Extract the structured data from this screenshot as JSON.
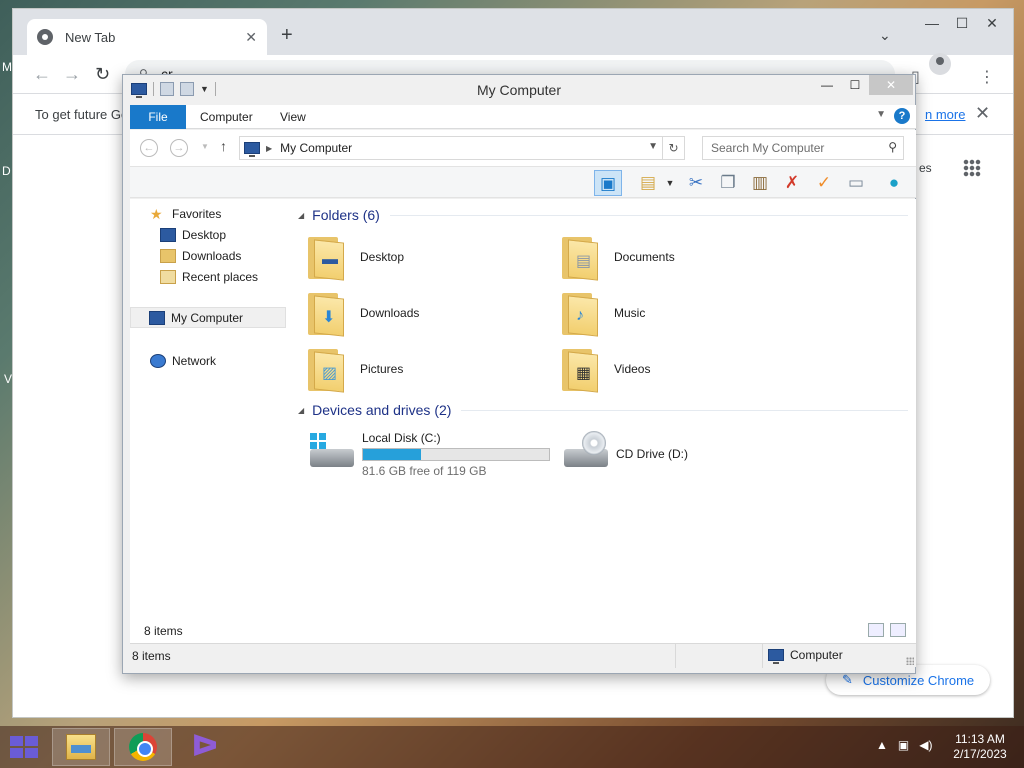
{
  "chrome": {
    "tab_title": "New Tab",
    "tab_close": "✕",
    "new_tab": "+",
    "tab_search": "⌄",
    "window_controls": {
      "minimize": "—",
      "maximize": "☐",
      "close": "✕"
    },
    "omnibox_value": "cr",
    "infobar": {
      "text": "To get future Go",
      "link": "n more",
      "close": "✕"
    },
    "edge_texts": {
      "left_1": "M",
      "left_2": "D",
      "left_3": "V",
      "right_1": "es"
    },
    "customize_label": "Customize Chrome"
  },
  "explorer": {
    "title": "My Computer",
    "window_controls": {
      "minimize": "—",
      "maximize": "☐",
      "close": "✕"
    },
    "ribbon_tabs": [
      "File",
      "Computer",
      "View"
    ],
    "help": "?",
    "address": "My Computer",
    "search_placeholder": "Search My Computer",
    "nav": {
      "favorites": "Favorites",
      "desktop": "Desktop",
      "downloads": "Downloads",
      "recent": "Recent places",
      "my_computer": "My Computer",
      "network": "Network"
    },
    "folders_header": "Folders (6)",
    "folders": [
      "Desktop",
      "Documents",
      "Downloads",
      "Music",
      "Pictures",
      "Videos"
    ],
    "devices_header": "Devices and drives (2)",
    "drives": [
      {
        "name": "Local Disk (C:)",
        "free_text": "81.6 GB free of 119 GB",
        "used_fraction": 0.314
      },
      {
        "name": "CD Drive (D:)"
      }
    ],
    "status_items": "8 items",
    "details_items": "8 items",
    "details_zone": "Computer"
  },
  "taskbar": {
    "time": "11:13 AM",
    "date": "2/17/2023"
  }
}
